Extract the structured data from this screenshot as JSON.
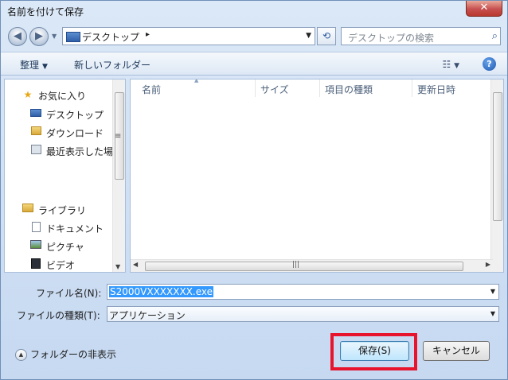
{
  "window": {
    "title": "名前を付けて保存",
    "close_label": "✕"
  },
  "address_bar": {
    "back_icon": "◀",
    "forward_icon": "▶",
    "path": "デスクトップ",
    "separator": "▸",
    "refresh_icon": "⟲",
    "search_placeholder": "デスクトップの検索",
    "search_icon": "⌕"
  },
  "toolbar": {
    "organize_label": "整理",
    "new_folder_label": "新しいフォルダー",
    "help_label": "?"
  },
  "nav_pane": {
    "favorites_label": "お気に入り",
    "items": [
      {
        "label": "デスクトップ",
        "icon": "desktop-icon"
      },
      {
        "label": "ダウンロード",
        "icon": "download-folder-icon"
      },
      {
        "label": "最近表示した場",
        "icon": "recent-places-icon"
      }
    ],
    "libraries_label": "ライブラリ",
    "library_items": [
      {
        "label": "ドキュメント",
        "icon": "document-icon"
      },
      {
        "label": "ピクチャ",
        "icon": "picture-icon"
      },
      {
        "label": "ビデオ",
        "icon": "video-icon"
      }
    ]
  },
  "file_list": {
    "columns": [
      "名前",
      "サイズ",
      "項目の種類",
      "更新日時"
    ]
  },
  "form": {
    "filename_label": "ファイル名(N):",
    "filename_value": "S2000VXXXXXXX.exe",
    "filetype_label": "ファイルの種類(T):",
    "filetype_value": "アプリケーション"
  },
  "footer": {
    "hide_folders_label": "フォルダーの非表示",
    "save_label": "保存(S)",
    "cancel_label": "キャンセル"
  },
  "colors": {
    "highlight_box": "#e8132d",
    "selection": "#3399ff"
  }
}
